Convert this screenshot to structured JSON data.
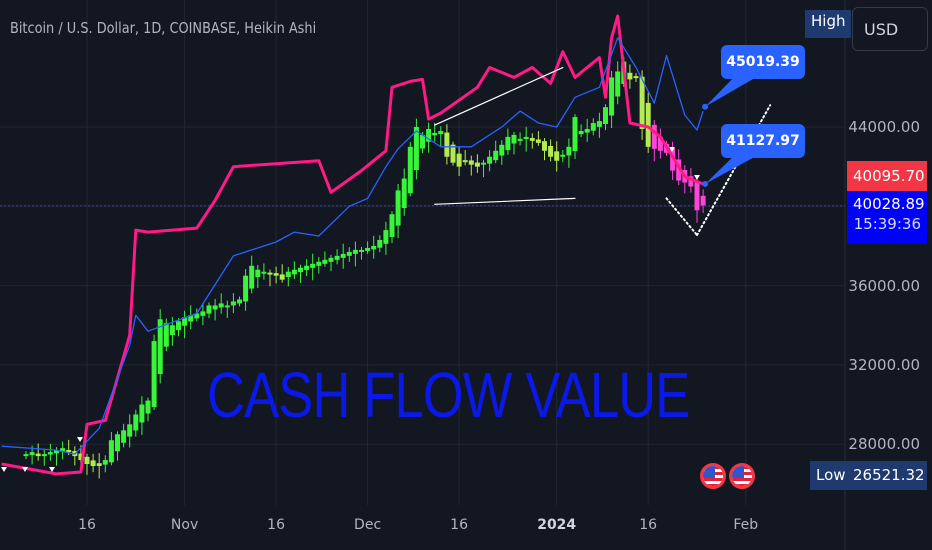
{
  "header": {
    "title": "Bitcoin / U.S. Dollar, 1D, COINBASE, Heikin Ashi",
    "currency": "USD"
  },
  "watermark": "CASH FLOW VALUE",
  "colors": {
    "background": "#131722",
    "up": "#39f53a",
    "down_uptrend": "#b4eb52",
    "down": "#ff44d8",
    "pink_line": "#ff1a86",
    "blue_line": "#2962ff",
    "callout": "#2962ff",
    "last_price": "#f23645",
    "current_price": "#0000ff"
  },
  "icons": [
    "us-flag-event-icon",
    "us-flag-event-icon"
  ],
  "chart_data": {
    "type": "candlestick",
    "title": "Bitcoin / U.S. Dollar, 1D, COINBASE, Heikin Ashi",
    "ylim": [
      25500,
      50500
    ],
    "xlim": [
      "2023-10-02",
      "2024-02-12"
    ],
    "grid": true,
    "y_ticks": [
      "44000.00",
      "36000.00",
      "32000.00",
      "28000.00"
    ],
    "x_ticks": [
      {
        "date": "2023-10-16",
        "label": "16"
      },
      {
        "date": "2023-11-01",
        "label": "Nov"
      },
      {
        "date": "2023-11-16",
        "label": "16"
      },
      {
        "date": "2023-12-01",
        "label": "Dec"
      },
      {
        "date": "2023-12-16",
        "label": "16"
      },
      {
        "date": "2024-01-01",
        "label": "2024",
        "bold": true
      },
      {
        "date": "2024-01-16",
        "label": "16"
      },
      {
        "date": "2024-02-01",
        "label": "Feb"
      }
    ],
    "candles": {
      "first": "2023-10-06",
      "last": "2024-01-25",
      "interval": "1D",
      "close": [
        27500,
        27600,
        27400,
        27500,
        27600,
        27700,
        27800,
        27600,
        27400,
        27200,
        27000,
        26900,
        26900,
        27200,
        28200,
        28500,
        28700,
        29000,
        29500,
        30000,
        30200,
        33200,
        34300,
        34100,
        34000,
        34200,
        34400,
        34500,
        34600,
        34700,
        35000,
        35000,
        35100,
        35000,
        35200,
        35300,
        36500,
        37000,
        36800,
        36700,
        36600,
        36500,
        36300,
        36700,
        36800,
        36900,
        37000,
        37100,
        37200,
        37300,
        37400,
        37500,
        37600,
        37700,
        37800,
        37800,
        37900,
        38000,
        38300,
        38800,
        39600,
        40800,
        41400,
        43000,
        44000,
        43600,
        43900,
        43700,
        43800,
        42500,
        42200,
        42000,
        42300,
        42100,
        42000,
        42200,
        42500,
        42800,
        43100,
        43500,
        43600,
        43400,
        43500,
        43300,
        43200,
        42800,
        42500,
        42300,
        42600,
        43000,
        44500,
        43800,
        43900,
        44200,
        44300,
        45000,
        46500,
        46800,
        47300,
        46400,
        46500,
        43900,
        43000,
        42900,
        42800,
        42700,
        41800,
        41300,
        41200,
        41000,
        39800,
        40050
      ]
    },
    "series": [
      {
        "type": "line",
        "color": "#ff1a86",
        "points": [
          [
            "2023-10-02",
            27000
          ],
          [
            "2023-10-11",
            26500
          ],
          [
            "2023-10-15",
            26600
          ],
          [
            "2023-10-16",
            29000
          ],
          [
            "2023-10-19",
            29200
          ],
          [
            "2023-10-23",
            33500
          ],
          [
            "2023-10-24",
            38800
          ],
          [
            "2023-10-26",
            38700
          ],
          [
            "2023-11-03",
            38900
          ],
          [
            "2023-11-06",
            40300
          ],
          [
            "2023-11-09",
            42000
          ],
          [
            "2023-11-23",
            42300
          ],
          [
            "2023-11-25",
            40700
          ],
          [
            "2023-11-30",
            41800
          ],
          [
            "2023-12-04",
            42800
          ],
          [
            "2023-12-05",
            46000
          ],
          [
            "2023-12-08",
            46300
          ],
          [
            "2023-12-10",
            46400
          ],
          [
            "2023-12-11",
            44400
          ],
          [
            "2023-12-13",
            44700
          ],
          [
            "2023-12-19",
            46000
          ],
          [
            "2023-12-21",
            47000
          ],
          [
            "2023-12-25",
            46500
          ],
          [
            "2023-12-28",
            47000
          ],
          [
            "2023-12-31",
            46200
          ],
          [
            "2024-01-02",
            47800
          ],
          [
            "2024-01-04",
            46500
          ],
          [
            "2024-01-08",
            47500
          ],
          [
            "2024-01-09",
            45500
          ],
          [
            "2024-01-10",
            48500
          ],
          [
            "2024-01-11",
            49600
          ],
          [
            "2024-01-13",
            44200
          ],
          [
            "2024-01-16",
            44000
          ],
          [
            "2024-01-18",
            43500
          ],
          [
            "2024-01-22",
            41500
          ],
          [
            "2024-01-25",
            41128
          ]
        ]
      },
      {
        "type": "line",
        "color": "#2962ff",
        "points": [
          [
            "2023-10-02",
            27900
          ],
          [
            "2023-10-11",
            27700
          ],
          [
            "2023-10-14",
            27500
          ],
          [
            "2023-10-18",
            28800
          ],
          [
            "2023-10-23",
            33000
          ],
          [
            "2023-10-24",
            34500
          ],
          [
            "2023-10-26",
            33700
          ],
          [
            "2023-11-03",
            34600
          ],
          [
            "2023-11-09",
            37500
          ],
          [
            "2023-11-16",
            38200
          ],
          [
            "2023-11-19",
            38700
          ],
          [
            "2023-11-23",
            38500
          ],
          [
            "2023-11-28",
            40000
          ],
          [
            "2023-12-01",
            40400
          ],
          [
            "2023-12-04",
            42000
          ],
          [
            "2023-12-06",
            42900
          ],
          [
            "2023-12-09",
            43800
          ],
          [
            "2023-12-13",
            43000
          ],
          [
            "2023-12-18",
            43000
          ],
          [
            "2023-12-23",
            44000
          ],
          [
            "2023-12-26",
            44800
          ],
          [
            "2023-12-29",
            44200
          ],
          [
            "2024-01-01",
            44000
          ],
          [
            "2024-01-04",
            45500
          ],
          [
            "2024-01-08",
            46000
          ],
          [
            "2024-01-11",
            48500
          ],
          [
            "2024-01-14",
            47000
          ],
          [
            "2024-01-17",
            45200
          ],
          [
            "2024-01-19",
            47600
          ],
          [
            "2024-01-22",
            44600
          ],
          [
            "2024-01-24",
            43850
          ],
          [
            "2024-01-25",
            44800
          ]
        ]
      }
    ],
    "trendlines": [
      {
        "style": "solid",
        "color": "#ffffff",
        "from": [
          "2023-12-12",
          44100
        ],
        "to": [
          "2024-01-02",
          47000
        ]
      },
      {
        "style": "solid",
        "color": "#ffffff",
        "from": [
          "2023-12-12",
          40100
        ],
        "to": [
          "2024-01-04",
          40400
        ]
      },
      {
        "style": "dotted",
        "color": "#ffffff",
        "from": [
          "2024-01-19",
          40400
        ],
        "to": [
          "2024-01-24",
          38550
        ]
      },
      {
        "style": "dotted",
        "color": "#ffffff",
        "from": [
          "2024-01-24",
          38550
        ],
        "to": [
          "2024-02-05",
          45100
        ]
      }
    ],
    "annotations": [
      {
        "label": "45019.39",
        "date": "2024-01-25",
        "value": 45019.39
      },
      {
        "label": "41127.97",
        "date": "2024-01-25",
        "value": 41127.97
      }
    ],
    "price_line": {
      "value": 40028.89
    }
  },
  "price_axis": {
    "high_label": "High",
    "low_label": "Low",
    "low_value": "26521.32",
    "last_price": "40095.70",
    "current_price": "40028.89",
    "countdown": "15:39:36"
  }
}
